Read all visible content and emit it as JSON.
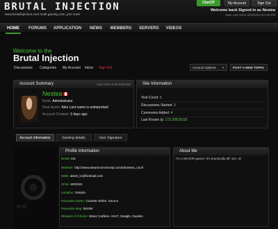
{
  "header": {
    "logo": "BRUTAL INJECTION",
    "tagline": "www.brutalinjection.com multi-gaming clan, join now!!",
    "buttons": {
      "clancp": "ClanCP",
      "my_account": "My Account",
      "sign_out": "Sign Out"
    },
    "welcome": "Welcome back Signed in as Nestea",
    "last_active": "Date Last Active 6/02/2010 at 8:40 PM"
  },
  "nav": {
    "items": [
      "HOME",
      "FORUMS",
      "APPLICATION",
      "NEWS",
      "MEMBERS",
      "SERVERS",
      "VIDEOS"
    ],
    "active": "HOME"
  },
  "title": {
    "welcome_to": "Welcome to the",
    "forum_name": "Brutal Injection"
  },
  "sublinks": {
    "discussions": "Discussions",
    "categories": "Categories",
    "my_account": "My Account",
    "inbox": "Inbox",
    "sign_out": "Sign Out"
  },
  "actions": {
    "account_options": "Account Options",
    "new_topic": "POST A NEW TOPIC"
  },
  "account_summary": {
    "heading": "Account Summary",
    "last_active": "Last Active 8 seconds ago",
    "name": "Nestea",
    "rank_label": "Rank:",
    "rank": "Administrator",
    "realname_label": "Real Name:",
    "realname": "Alex Last name is unimportant",
    "created_label": "Account Created:",
    "created": "3 days ago"
  },
  "site_info": {
    "heading": "Site Information",
    "visit_label": "Visit Count:",
    "visit": "5",
    "started_label": "Discussions Started:",
    "started": "3",
    "comments_label": "Comments Added:",
    "comments": "4",
    "ip_label": "Last Known Ip:",
    "ip": "173.206.50.52"
  },
  "tabs": [
    "Account information",
    "Gaming details",
    "User Signature"
  ],
  "profile": {
    "heading": "Profile Information",
    "email_label": "Email:",
    "email": "n/a",
    "website_label": "Website:",
    "website": "http://www.steamcommunity.com/id/nestea_cool/",
    "msn_label": "MSN:",
    "msn": "alex9_sc@hotmail.com",
    "xfire_label": "XFire:",
    "xfire": "MIDS25",
    "location_label": "Location:",
    "location": "Ontario",
    "game_label": "Favourite Game:",
    "game": "Counter-Strike: Source",
    "map_label": "Favourite Map:",
    "map": "Border",
    "weapon_label": "Weapon of Choice:",
    "weapon": "M4a1 Carbine, AK47, Deagle, Dualies"
  },
  "about": {
    "heading": "About Me",
    "text": "I'm a MAJOR gamer. It's practically all i do! =D"
  },
  "sidebar": {
    "emblem_text": "BIO"
  },
  "colors": {
    "accent": "#3a9b2c",
    "green_text": "#4ac23a",
    "danger": "#d83a3a"
  }
}
